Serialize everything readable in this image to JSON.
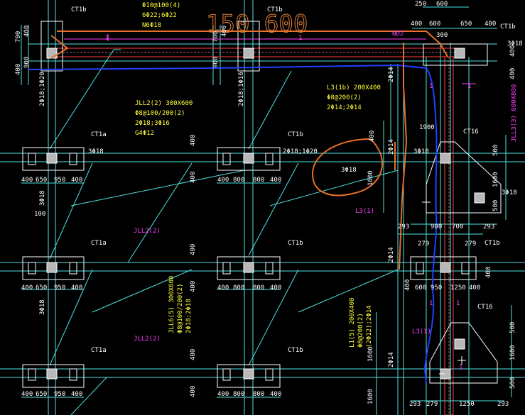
{
  "colors": {
    "background": "#000000",
    "cyan": "#4fe3e3",
    "white": "#ffffff",
    "yellow": "#ffff3a",
    "magenta": "#ff40ff",
    "red": "#ff4040",
    "orange": "#e8702a",
    "blue": "#2040ff",
    "grey": "#a0a0a0"
  },
  "pile_caps": {
    "ct1b": "CT1b",
    "ct1a": "CT1a",
    "ct16": "CT16"
  },
  "overlay": {
    "handwritten_number": "150 600"
  },
  "beams": {
    "top_note_1": "Φ10@100(4)",
    "top_note_2": "6Φ22;6Φ22",
    "top_note_3": "N6Φ18",
    "jll2_title": "JLL2(2) 300X600",
    "jll2_stirrup": "Φ8@100/200(2)",
    "jll2_bars": "2Φ18;3Φ16",
    "jll2_side": "G4Φ12",
    "jll2_2": "JLL2(2)",
    "jll6_title": "JLL6(5) 300X600",
    "jll6_stirrup": "Φ8@100/200(2)",
    "jll6_bars": "2Φ18;2Φ18",
    "l3_1b_title": "L3(1b) 200X400",
    "l3_1b_stirrup": "Φ8@200(2)",
    "l3_1b_bars": "2Φ14;2Φ14",
    "l3_1": "L3(1)",
    "l145_title": "L1(5) 200X400",
    "l145_stirrup": "Φ8@200(2)",
    "l145_bars": "(2Φ12);2Φ14",
    "jll3_title": "JLL3(3) 600X800",
    "nd2": "ND2"
  },
  "rebar": {
    "r3_18": "3Φ18",
    "r2_18_1_20": "2Φ18;1Φ20",
    "r2_18_1_16": "2Φ18;1Φ16",
    "r2_14": "2Φ14"
  },
  "dims": {
    "d400": "400",
    "d650": "650",
    "d950": "950",
    "d800": "800",
    "d700": "700",
    "d900": "900",
    "d250": "250",
    "d600": "600",
    "d300": "300",
    "d100": "100",
    "d500": "500",
    "d1600": "1600",
    "d1900": "1900",
    "d293": "293",
    "d279": "279",
    "d1250": "1250",
    "d1": "1"
  }
}
